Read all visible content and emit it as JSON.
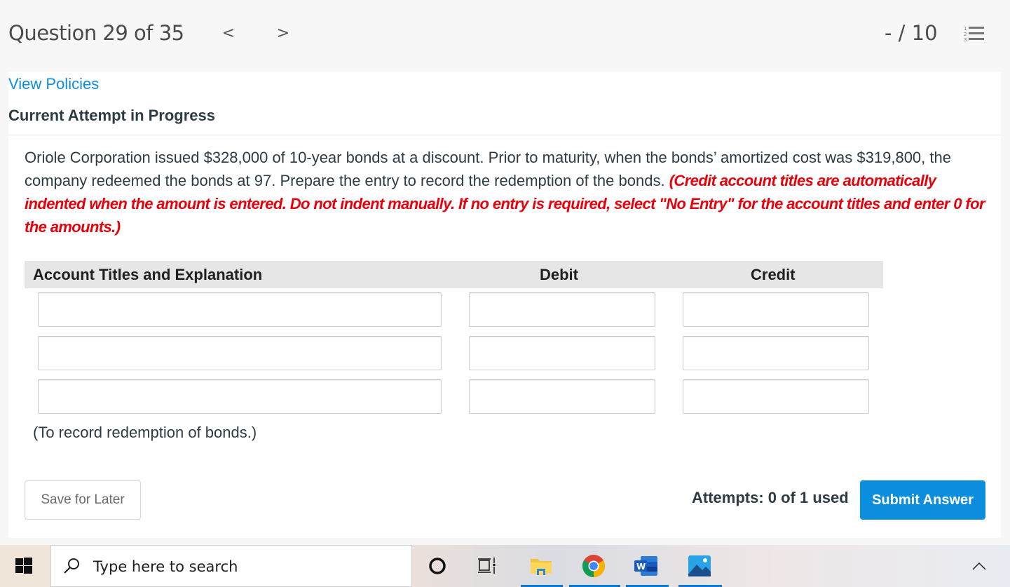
{
  "header": {
    "question_counter": "Question 29 of 35",
    "prev_icon": "chevron-left-icon",
    "prev_glyph": "<",
    "next_icon": "chevron-right-icon",
    "next_glyph": ">",
    "score": "- / 10",
    "question_list_icon": "numbered-list-icon"
  },
  "panel": {
    "view_policies_link": "View Policies",
    "attempt_heading": "Current Attempt in Progress",
    "question_text": "Oriole Corporation issued $328,000 of 10-year bonds at a discount. Prior to maturity, when the bonds’ amortized cost was $319,800, the company redeemed the bonds at 97. Prepare the entry to record the redemption of the bonds.",
    "instructions": "(Credit account titles are automatically indented when the amount is entered. Do not indent manually. If no entry is required, select \"No Entry\" for the account titles and enter 0 for the amounts.)"
  },
  "journal": {
    "columns": [
      "Account Titles and Explanation",
      "Debit",
      "Credit"
    ],
    "rows": [
      {
        "account": "",
        "debit": "",
        "credit": ""
      },
      {
        "account": "",
        "debit": "",
        "credit": ""
      },
      {
        "account": "",
        "debit": "",
        "credit": ""
      }
    ],
    "note": "(To record redemption of bonds.)"
  },
  "footer": {
    "save_label": "Save for Later",
    "attempts_text": "Attempts: 0 of 1 used",
    "submit_label": "Submit Answer"
  },
  "taskbar": {
    "start_icon": "windows-start-icon",
    "search_placeholder": "Type here to search",
    "apps": [
      {
        "name": "cortana-icon",
        "active": false
      },
      {
        "name": "task-view-icon",
        "active": false
      },
      {
        "name": "file-explorer-icon",
        "active": true
      },
      {
        "name": "chrome-icon",
        "active": true
      },
      {
        "name": "word-icon",
        "active": true
      },
      {
        "name": "photos-icon",
        "active": true
      }
    ],
    "tray_icon": "show-hidden-icons-chevron"
  },
  "colors": {
    "accent": "#0b8ede",
    "instruction_red": "#e8000b",
    "text": "#2d3b45",
    "header_bg": "#f7f7f7",
    "table_header_bg": "#e6e6e6"
  }
}
